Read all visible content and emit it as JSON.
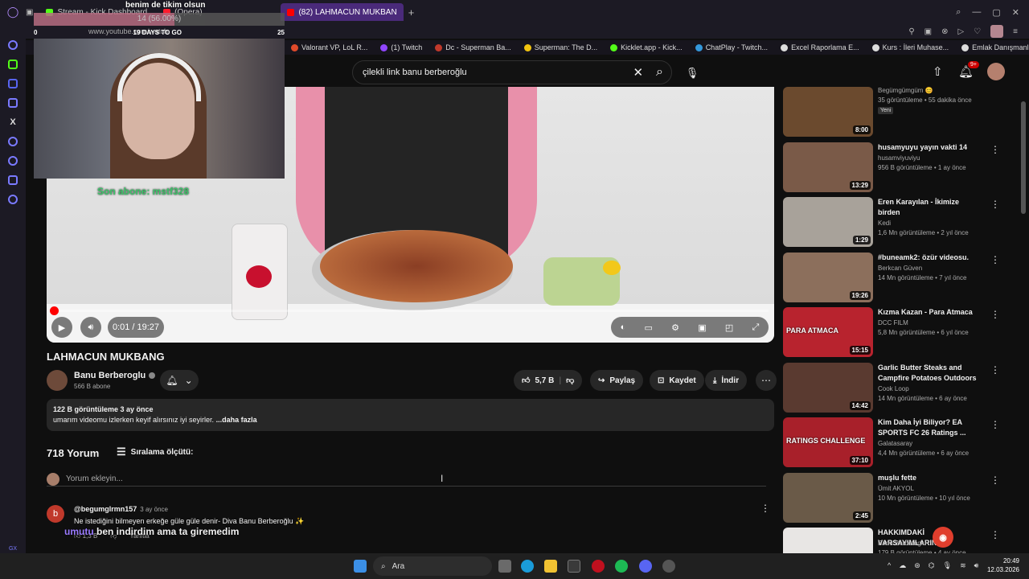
{
  "browser": {
    "tabs": [
      {
        "label": "Stream - Kick Dashboard",
        "color": "#53fc18"
      },
      {
        "label": "(Opera)",
        "color": "#ff1b2d"
      },
      {
        "label": "(82) LAHMACUN MUKBAN",
        "color": "#ff0000",
        "active": true
      }
    ],
    "url": "www.youtube.com/watch",
    "bookmarks": [
      {
        "label": "Valorant VP, LoL R...",
        "color": "#e04a2a"
      },
      {
        "label": "(1) Twitch",
        "color": "#9146ff"
      },
      {
        "label": "Dc - Superman Ba...",
        "color": "#c0392b"
      },
      {
        "label": "Superman: The D...",
        "color": "#f1c40f"
      },
      {
        "label": "Kicklet.app - Kick...",
        "color": "#53fc18"
      },
      {
        "label": "ChatPlay - Twitch...",
        "color": "#3498db"
      },
      {
        "label": "Excel Raporlama E...",
        "color": "#dddddd"
      },
      {
        "label": "Kurs : İleri Muhase...",
        "color": "#dddddd"
      },
      {
        "label": "Emlak Danışmanlı...",
        "color": "#dddddd"
      }
    ]
  },
  "overlay": {
    "goal_title": "benim de tikim olsun",
    "goal_progress": "14 (56.00%)",
    "goal_fraction": 0.56,
    "goal_left": "0",
    "goal_days": "19 DAYS TO GO",
    "goal_target": "25",
    "last_sub": "Son abone: mstf328"
  },
  "search": {
    "query": "çilekli link banu berberoğlu"
  },
  "header": {
    "notifications": "9+"
  },
  "video": {
    "time": "0:01 / 19:27",
    "progress_fraction": 0.001,
    "title": "LAHMACUN MUKBANG",
    "channel": "Banu Berberoglu",
    "subscribers": "566 B abone",
    "likes": "5,7 B",
    "share": "Paylaş",
    "save": "Kaydet",
    "download": "İndir",
    "views_date": "122 B görüntüleme  3 ay önce",
    "description": "umarım videomu izlerken keyif alırsınız iyi seyirler.",
    "more": "...daha fazla"
  },
  "comments": {
    "count": "718 Yorum",
    "sort_label": "Sıralama ölçütü:",
    "add_placeholder": "Yorum ekleyin...",
    "first": {
      "avatar_letter": "b",
      "user": "@begumglrmn157",
      "time": "3 ay önce",
      "text": "Ne istediğini bilmeyen erkeğe güle güle denir- Diva Banu Berberoğlu ✨",
      "likes": "1,3 B",
      "reply": "Yanıtla"
    }
  },
  "chat": {
    "user": "umutu",
    "message": "ben indirdim ama ta giremedim"
  },
  "recommendations": [
    {
      "title": "",
      "channel": "Begümgümgüm 😊",
      "meta": "35 görüntüleme • 55 dakika önce",
      "badge": "Yeni",
      "duration": "8:00",
      "thumb": "#6b4a2e"
    },
    {
      "title": "husamyuyu yayın vakti 14",
      "channel": "husamviyuviyu",
      "meta": "956 B görüntüleme • 1 ay önce",
      "duration": "13:29",
      "thumb": "#7a5a48"
    },
    {
      "title": "Eren Karayılan - İkimize birden",
      "channel": "Kedi",
      "meta": "1,6 Mn görüntüleme • 2 yıl önce",
      "duration": "1:29",
      "thumb": "#a8a29a"
    },
    {
      "title": "#buneamk2: özür videosu.",
      "channel": "Berkcan Güven",
      "meta": "14 Mn görüntüleme • 7 yıl önce",
      "duration": "19:26",
      "thumb": "#8c6f5c"
    },
    {
      "title": "Kızma Kazan - Para Atmaca",
      "channel": "DCC FILM",
      "meta": "5,8 Mn görüntüleme • 6 yıl önce",
      "duration": "15:15",
      "thumb": "#b8232e",
      "thumb_text": "PARA ATMACA"
    },
    {
      "title": "Garlic Butter Steaks and Campfire Potatoes Outdoors",
      "channel": "Cook Loop",
      "meta": "14 Mn görüntüleme • 6 ay önce",
      "duration": "14:42",
      "thumb": "#5a3a30"
    },
    {
      "title": "Kim Daha İyi Biliyor? EA SPORTS FC 26 Ratings ...",
      "channel": "Galatasaray",
      "meta": "4,4 Mn görüntüleme • 6 ay önce",
      "duration": "37:10",
      "thumb": "#a8202a",
      "thumb_text": "RATINGS CHALLENGE"
    },
    {
      "title": "muşlu fette",
      "channel": "Ümit AKYOL",
      "meta": "10 Mn görüntüleme • 10 yıl önce",
      "duration": "2:45",
      "thumb": "#6a5a48"
    },
    {
      "title": "HAKKIMDAKİ VARSAYIMLARINIZ",
      "channel": "Banu Berberoglu",
      "meta": "179 B görüntüleme • 4 ay önce",
      "duration": "",
      "thumb": "#e8e6e4"
    }
  ],
  "taskbar": {
    "search_label": "Ara",
    "time": "20:49",
    "date": "12.03.2026"
  }
}
